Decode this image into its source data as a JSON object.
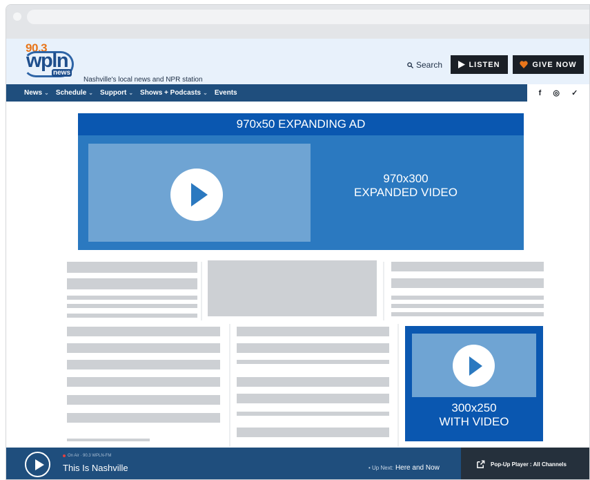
{
  "header": {
    "logo_number": "90.3",
    "logo_word": "wpln",
    "logo_sub": "news",
    "tagline": "Nashville's local news and NPR station",
    "search_label": "Search",
    "listen_label": "LISTEN",
    "give_label": "GIVE NOW"
  },
  "nav": {
    "items": [
      {
        "label": "News"
      },
      {
        "label": "Schedule"
      },
      {
        "label": "Support"
      },
      {
        "label": "Shows + Podcasts"
      },
      {
        "label": "Events"
      }
    ],
    "social": [
      "f",
      "◎",
      "✓"
    ]
  },
  "ads": {
    "top_banner": "970x50 EXPANDING AD",
    "expanded_line1": "970x300",
    "expanded_line2": "EXPANDED VIDEO",
    "small_line1": "300x250",
    "small_line2": "WITH VIDEO"
  },
  "player": {
    "on_air": "On Air · 90.3 WPLN-FM",
    "show_title": "This Is Nashville",
    "up_next_label": "• Up Next:",
    "up_next_show": "Here and Now",
    "popup_label": "Pop-Up Player : All Channels"
  },
  "colors": {
    "nav_bg": "#1f4e7d",
    "ad_dark": "#0a57b0",
    "ad_mid": "#2b79c0",
    "ad_light": "#6fa4d3",
    "placeholder": "#cdd0d4"
  }
}
